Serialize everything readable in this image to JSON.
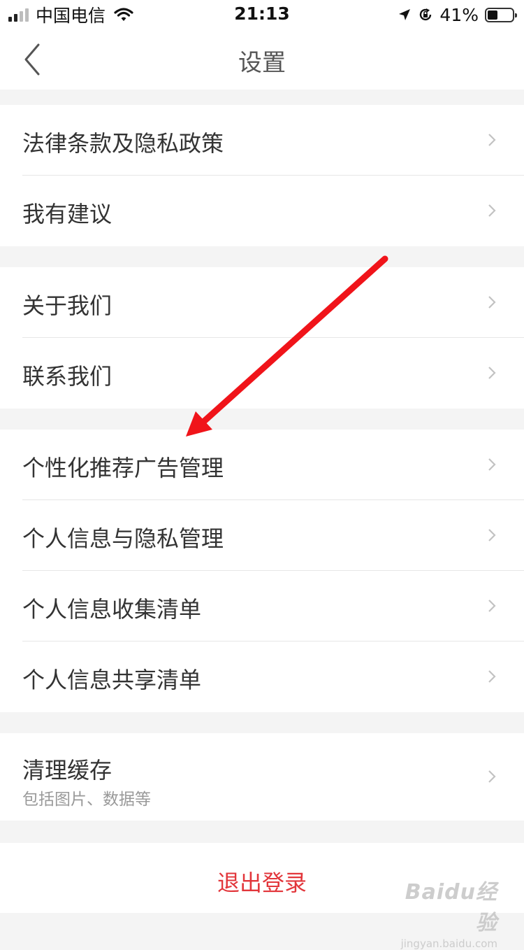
{
  "status_bar": {
    "carrier": "中国电信",
    "time": "21:13",
    "battery_percent": "41%",
    "battery_level": 0.41,
    "icons": [
      "signal-icon",
      "wifi-icon",
      "location-arrow-icon",
      "rotation-lock-icon",
      "battery-icon"
    ]
  },
  "nav": {
    "title": "设置",
    "back_icon": "chevron-left-icon"
  },
  "groups": [
    {
      "items": [
        {
          "label": "法律条款及隐私政策"
        },
        {
          "label": "我有建议"
        }
      ]
    },
    {
      "items": [
        {
          "label": "关于我们"
        },
        {
          "label": "联系我们"
        }
      ]
    },
    {
      "items": [
        {
          "label": "个性化推荐广告管理"
        },
        {
          "label": "个人信息与隐私管理"
        },
        {
          "label": "个人信息收集清单"
        },
        {
          "label": "个人信息共享清单"
        }
      ]
    },
    {
      "items": [
        {
          "label": "清理缓存",
          "sublabel": "包括图片、数据等"
        }
      ]
    }
  ],
  "logout": {
    "label": "退出登录"
  },
  "colors": {
    "accent_red": "#e2363b",
    "annotation_arrow": "#f0141a",
    "background": "#f4f4f4"
  },
  "watermark": {
    "main": "Baidu经验",
    "sub": "jingyan.baidu.com"
  }
}
